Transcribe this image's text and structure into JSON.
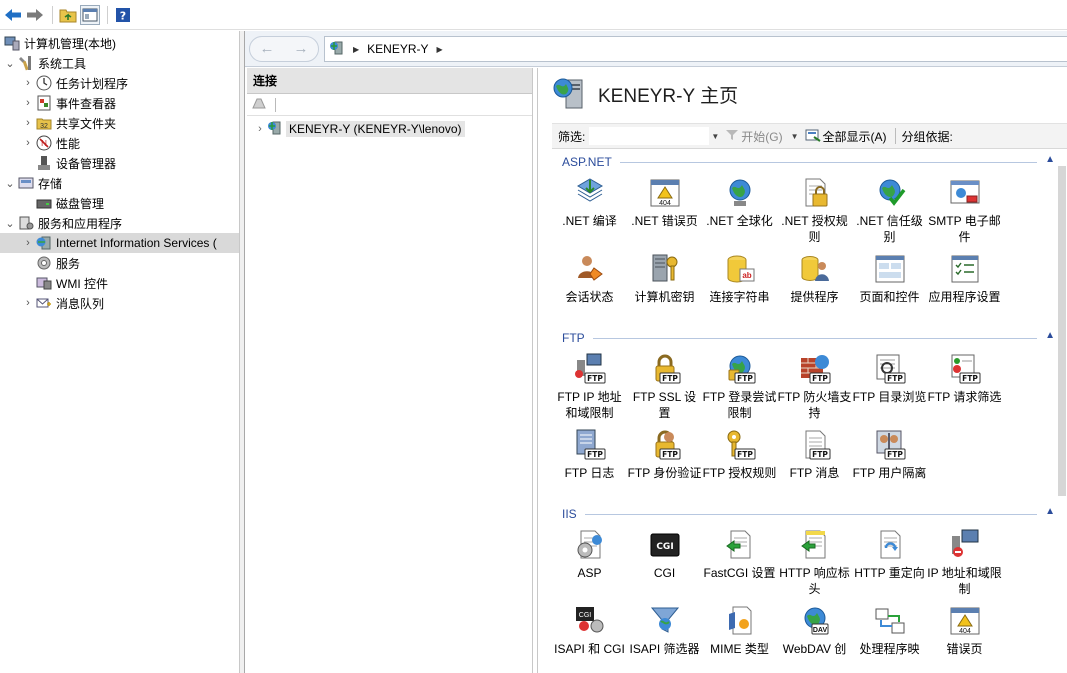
{
  "toolbar": {
    "icons": [
      "back-icon",
      "forward-icon",
      "up-folder-icon",
      "show-hide-console-tree-icon",
      "help-icon"
    ]
  },
  "tree": {
    "items": [
      {
        "label": "计算机管理(本地)",
        "level": 0,
        "expander": "",
        "icon": "computer-management-icon"
      },
      {
        "label": "系统工具",
        "level": 1,
        "expander": "⌄",
        "icon": "tools-icon"
      },
      {
        "label": "任务计划程序",
        "level": 2,
        "expander": "›",
        "icon": "clock-icon"
      },
      {
        "label": "事件查看器",
        "level": 2,
        "expander": "›",
        "icon": "event-viewer-icon"
      },
      {
        "label": "共享文件夹",
        "level": 2,
        "expander": "›",
        "icon": "shared-folder-icon"
      },
      {
        "label": "性能",
        "level": 2,
        "expander": "›",
        "icon": "performance-icon"
      },
      {
        "label": "设备管理器",
        "level": 2,
        "expander": "",
        "icon": "device-manager-icon"
      },
      {
        "label": "存储",
        "level": 1,
        "expander": "⌄",
        "icon": "storage-icon"
      },
      {
        "label": "磁盘管理",
        "level": 2,
        "expander": "",
        "icon": "disk-icon"
      },
      {
        "label": "服务和应用程序",
        "level": 1,
        "expander": "⌄",
        "icon": "services-apps-icon"
      },
      {
        "label": "Internet Information Services (",
        "level": 2,
        "expander": "›",
        "icon": "iis-icon",
        "selected": true
      },
      {
        "label": "服务",
        "level": 2,
        "expander": "",
        "icon": "services-icon"
      },
      {
        "label": "WMI 控件",
        "level": 2,
        "expander": "",
        "icon": "wmi-icon"
      },
      {
        "label": "消息队列",
        "level": 2,
        "expander": "›",
        "icon": "message-queue-icon"
      }
    ]
  },
  "address": {
    "crumb": "KENEYR-Y"
  },
  "connections": {
    "title": "连接",
    "node_label": "KENEYR-Y (KENEYR-Y\\lenovo)"
  },
  "main": {
    "title": "KENEYR-Y 主页",
    "filter_label": "筛选:",
    "go_label": "开始(G)",
    "show_all_label": "全部显示(A)",
    "group_by_label": "分组依据:",
    "groups": [
      {
        "name": "ASP.NET",
        "features": [
          {
            "label": ".NET 编译",
            "icon": "net-compile-icon"
          },
          {
            "label": ".NET 错误页",
            "icon": "net-error-pages-icon"
          },
          {
            "label": ".NET 全球化",
            "icon": "net-globalization-icon"
          },
          {
            "label": ".NET 授权规则",
            "icon": "net-authorization-icon"
          },
          {
            "label": ".NET 信任级别",
            "icon": "net-trust-levels-icon"
          },
          {
            "label": "SMTP 电子邮件",
            "icon": "smtp-email-icon"
          },
          {
            "label": "会话状态",
            "icon": "session-state-icon"
          },
          {
            "label": "计算机密钥",
            "icon": "machine-key-icon"
          },
          {
            "label": "连接字符串",
            "icon": "connection-strings-icon"
          },
          {
            "label": "提供程序",
            "icon": "providers-icon"
          },
          {
            "label": "页面和控件",
            "icon": "pages-controls-icon"
          },
          {
            "label": "应用程序设置",
            "icon": "app-settings-icon"
          }
        ]
      },
      {
        "name": "FTP",
        "features": [
          {
            "label": "FTP IP 地址和域限制",
            "icon": "ftp-ip-restrictions-icon"
          },
          {
            "label": "FTP SSL 设置",
            "icon": "ftp-ssl-icon"
          },
          {
            "label": "FTP 登录尝试限制",
            "icon": "ftp-logon-attempts-icon"
          },
          {
            "label": "FTP 防火墙支持",
            "icon": "ftp-firewall-icon"
          },
          {
            "label": "FTP 目录浏览",
            "icon": "ftp-directory-browsing-icon"
          },
          {
            "label": "FTP 请求筛选",
            "icon": "ftp-request-filtering-icon"
          },
          {
            "label": "FTP 日志",
            "icon": "ftp-logging-icon"
          },
          {
            "label": "FTP 身份验证",
            "icon": "ftp-authentication-icon"
          },
          {
            "label": "FTP 授权规则",
            "icon": "ftp-authorization-icon"
          },
          {
            "label": "FTP 消息",
            "icon": "ftp-messages-icon"
          },
          {
            "label": "FTP 用户隔离",
            "icon": "ftp-user-isolation-icon"
          }
        ]
      },
      {
        "name": "IIS",
        "features": [
          {
            "label": "ASP",
            "icon": "asp-icon"
          },
          {
            "label": "CGI",
            "icon": "cgi-icon"
          },
          {
            "label": "FastCGI 设置",
            "icon": "fastcgi-icon"
          },
          {
            "label": "HTTP 响应标头",
            "icon": "http-response-headers-icon"
          },
          {
            "label": "HTTP 重定向",
            "icon": "http-redirect-icon"
          },
          {
            "label": "IP 地址和域限制",
            "icon": "ip-restrictions-icon"
          },
          {
            "label": "ISAPI 和 CGI",
            "icon": "isapi-cgi-restrictions-icon"
          },
          {
            "label": "ISAPI 筛选器",
            "icon": "isapi-filters-icon"
          },
          {
            "label": "MIME 类型",
            "icon": "mime-types-icon"
          },
          {
            "label": "WebDAV 创",
            "icon": "webdav-icon"
          },
          {
            "label": "处理程序映",
            "icon": "handler-mappings-icon"
          },
          {
            "label": "错误页",
            "icon": "error-pages-icon"
          }
        ]
      }
    ]
  }
}
